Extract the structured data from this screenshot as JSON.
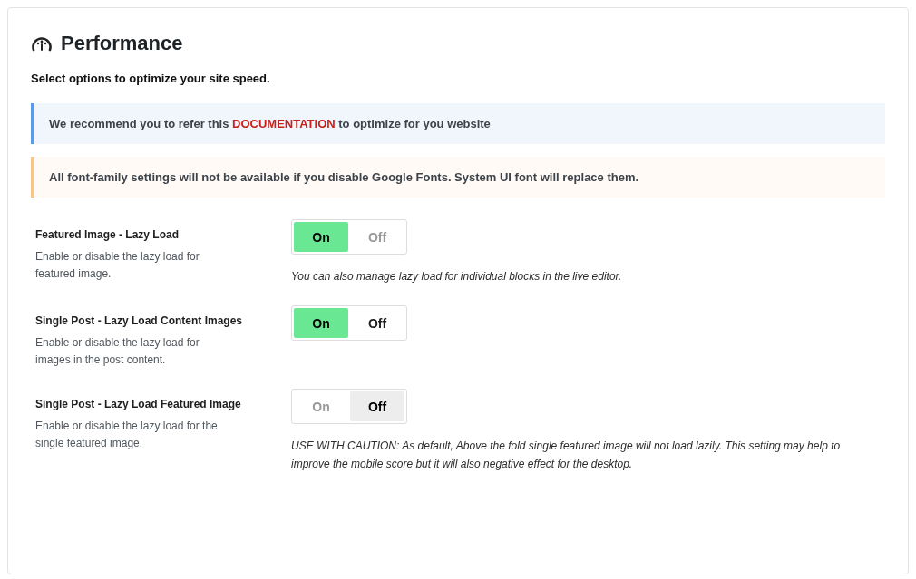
{
  "header": {
    "title": "Performance",
    "subtitle": "Select options to optimize your site speed."
  },
  "notices": [
    {
      "kind": "info",
      "before": "We recommend you to refer this ",
      "link": "DOCUMENTATION",
      "after": " to optimize for you website"
    },
    {
      "kind": "warning",
      "text": "All font-family settings will not be available if you disable Google Fonts. System UI font will replace them."
    }
  ],
  "settings": [
    {
      "label": "Featured Image - Lazy Load",
      "description": "Enable or disable the lazy load for featured image.",
      "options": [
        {
          "label": "On",
          "selected": true,
          "dimmed": false
        },
        {
          "label": "Off",
          "selected": false,
          "dimmed": true
        }
      ],
      "note": "You can also manage lazy load for individual blocks in the live editor."
    },
    {
      "label": "Single Post - Lazy Load Content Images",
      "description": "Enable or disable the lazy load for images in the post content.",
      "options": [
        {
          "label": "On",
          "selected": true,
          "dimmed": false
        },
        {
          "label": "Off",
          "selected": false,
          "dimmed": false
        }
      ]
    },
    {
      "label": "Single Post - Lazy Load Featured Image",
      "description": "Enable or disable the lazy load for the single featured image.",
      "options": [
        {
          "label": "On",
          "selected": false,
          "dimmed": true
        },
        {
          "label": "Off",
          "selected": true,
          "dimmed": false
        }
      ],
      "note": "USE WITH CAUTION: As default, Above the fold single featured image will not load lazily. This setting may help to improve the mobile score but it will also negative effect for the desktop."
    }
  ]
}
